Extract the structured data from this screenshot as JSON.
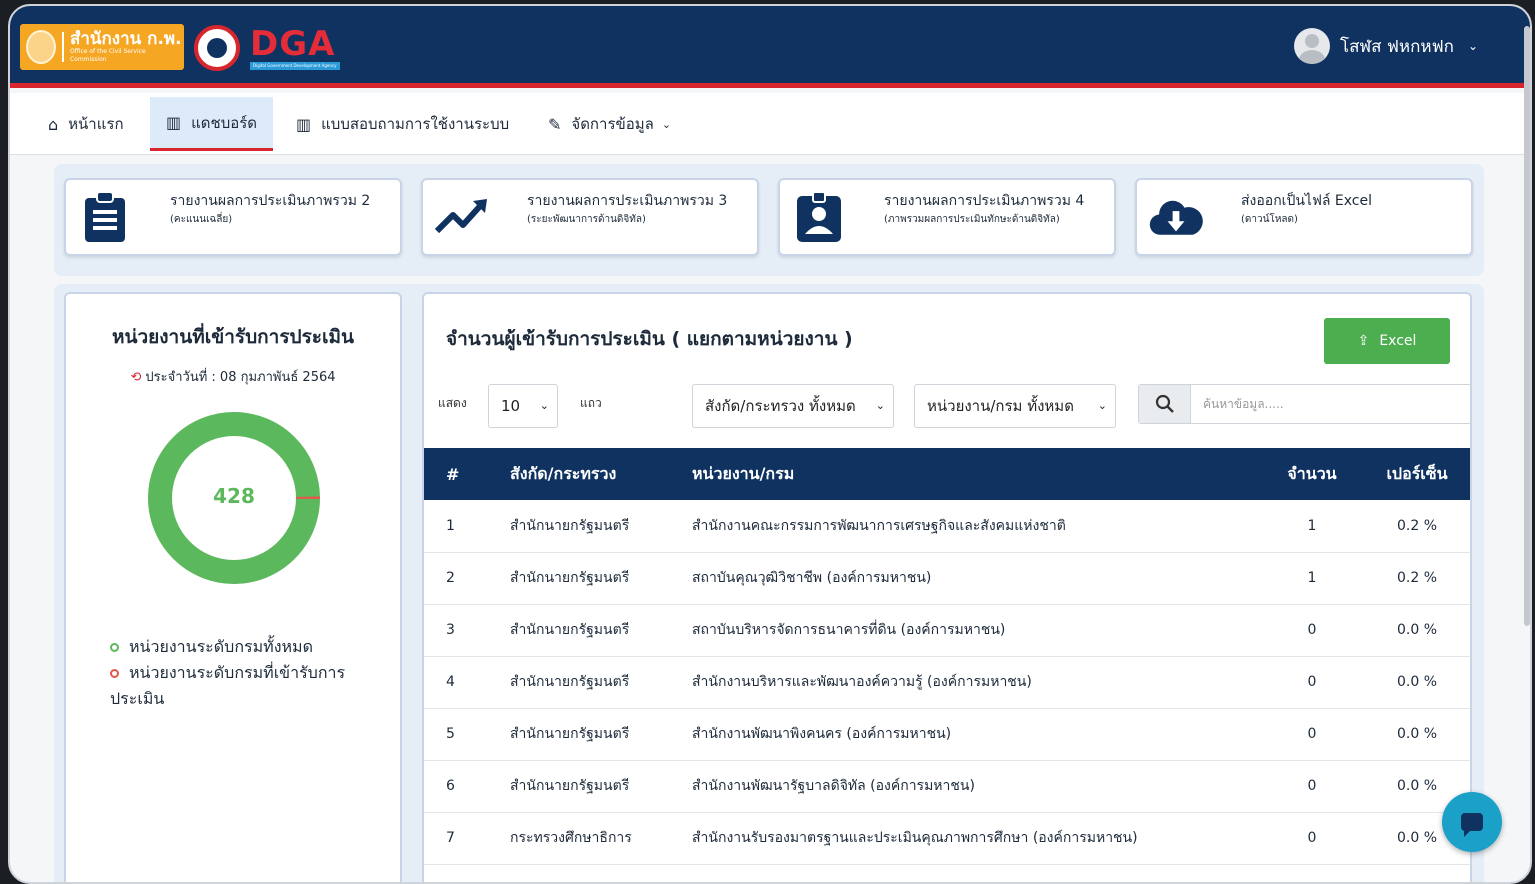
{
  "header": {
    "ocsc_logo_text": "สำนักงาน ก.พ.",
    "ocsc_logo_sub": "Office of the Civil Service Commission",
    "dga_logo_text": "DGA",
    "dga_logo_sub": "Digital Government Development Agency",
    "user_name": "โสฬส ฟหกหฟก"
  },
  "nav": {
    "home": "หน้าแรก",
    "dashboard": "แดชบอร์ด",
    "survey": "แบบสอบถามการใช้งานระบบ",
    "manage": "จัดการข้อมูล"
  },
  "cards": [
    {
      "title": "รายงานผลการประเมินภาพรวม 2",
      "sub": "(คะแนนเฉลี่ย)",
      "icon": "clipboard-icon"
    },
    {
      "title": "รายงานผลการประเมินภาพรวม 3",
      "sub": "(ระยะพัฒนาการด้านดิจิทัล)",
      "icon": "trend-up-icon"
    },
    {
      "title": "รายงานผลการประเมินภาพรวม 4",
      "sub": "(ภาพรวมผลการประเมินทักษะด้านดิจิทัล)",
      "icon": "id-badge-icon"
    },
    {
      "title": "ส่งออกเป็นไฟล์ Excel",
      "sub": "(ดาวน์โหลด)",
      "icon": "cloud-download-icon"
    }
  ],
  "left_panel": {
    "title": "หน่วยงานที่เข้ารับการประเมิน",
    "date_label": "ประจำวันที่ : 08 กุมภาพันธ์ 2564",
    "donut_value": "428",
    "donut_total": 428,
    "donut_assessed": 2,
    "legend_total": "หน่วยงานระดับกรมทั้งหมด",
    "legend_assessed": "หน่วยงานระดับกรมที่เข้ารับการประเมิน",
    "colors": {
      "total": "#5cb85c",
      "assessed": "#e8574a"
    }
  },
  "right_panel": {
    "title": "จำนวนผู้เข้ารับการประเมิน ( แยกตามหน่วยงาน )",
    "excel_label": "Excel",
    "show_label": "แสดง",
    "page_size": "10",
    "rows_label": "แถว",
    "ministry_filter": "สังกัด/กระทรวง ทั้งหมด",
    "dept_filter": "หน่วยงาน/กรม ทั้งหมด",
    "search_placeholder": "ค้นหาข้อมูล.....",
    "columns": [
      "#",
      "สังกัด/กระทรวง",
      "หน่วยงาน/กรม",
      "จำนวน",
      "เปอร์เซ็น"
    ],
    "rows": [
      [
        "1",
        "สำนักนายกรัฐมนตรี",
        "สำนักงานคณะกรรมการพัฒนาการเศรษฐกิจและสังคมแห่งชาติ",
        "1",
        "0.2 %"
      ],
      [
        "2",
        "สำนักนายกรัฐมนตรี",
        "สถาบันคุณวุฒิวิชาชีพ (องค์การมหาชน)",
        "1",
        "0.2 %"
      ],
      [
        "3",
        "สำนักนายกรัฐมนตรี",
        "สถาบันบริหารจัดการธนาคารที่ดิน (องค์การมหาชน)",
        "0",
        "0.0 %"
      ],
      [
        "4",
        "สำนักนายกรัฐมนตรี",
        "สำนักงานบริหารและพัฒนาองค์ความรู้ (องค์การมหาชน)",
        "0",
        "0.0 %"
      ],
      [
        "5",
        "สำนักนายกรัฐมนตรี",
        "สำนักงานพัฒนาพิงคนคร (องค์การมหาชน)",
        "0",
        "0.0 %"
      ],
      [
        "6",
        "สำนักนายกรัฐมนตรี",
        "สำนักงานพัฒนารัฐบาลดิจิทัล (องค์การมหาชน)",
        "0",
        "0.0 %"
      ],
      [
        "7",
        "กระทรวงศึกษาธิการ",
        "สำนักงานรับรองมาตรฐานและประเมินคุณภาพการศึกษา (องค์การมหาชน)",
        "0",
        "0.0 %"
      ]
    ]
  },
  "colors": {
    "navy": "#0f3260",
    "accent_red": "#d7262e",
    "green": "#4cae4f"
  }
}
